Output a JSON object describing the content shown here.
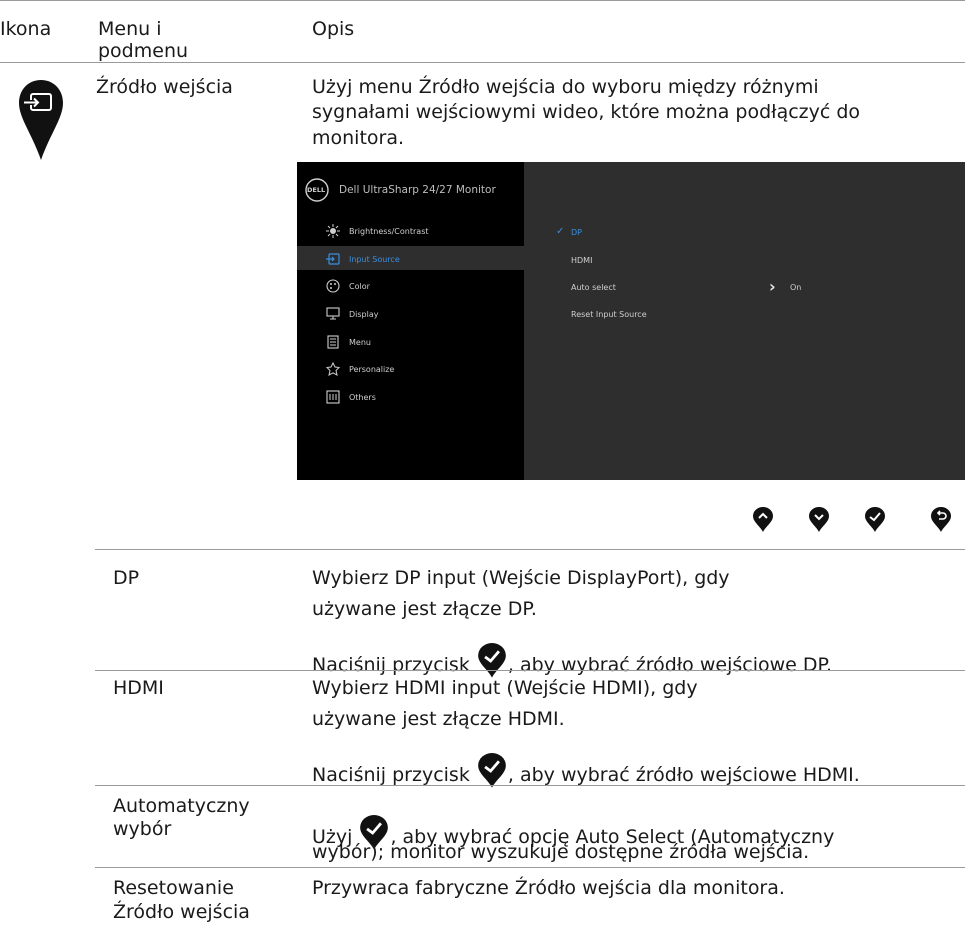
{
  "header": {
    "col_icon": "Ikona",
    "col_menu_l1": "Menu i",
    "col_menu_l2": "podmenu",
    "col_desc": "Opis"
  },
  "input_source": {
    "title": "Źródło wejścia",
    "desc_l1": "Użyj menu Źródło wejścia do wyboru między różnymi",
    "desc_l2": "sygnałami wejściowymi wideo, które można podłączyć do",
    "desc_l3": "monitora."
  },
  "osd": {
    "logo": "DELL",
    "title": "Dell UltraSharp 24/27 Monitor",
    "menu": [
      "Brightness/Contrast",
      "Input Source",
      "Color",
      "Display",
      "Menu",
      "Personalize",
      "Others"
    ],
    "options": [
      "DP",
      "HDMI",
      "Auto select",
      "Reset Input Source"
    ],
    "checkmark": "✓",
    "auto_value": "On",
    "arrow": "›"
  },
  "buttons": [
    "up-icon",
    "down-icon",
    "check-icon",
    "back-icon"
  ],
  "rows": {
    "dp": {
      "name": "DP",
      "l1": "Wybierz DP input (Wejście DisplayPort), gdy",
      "l2": "używane jest złącze DP.",
      "l3a": "Naciśnij przycisk ",
      "l3b": ", aby wybrać źródło wejściowe DP."
    },
    "hdmi": {
      "name": "HDMI",
      "l1": "Wybierz HDMI input (Wejście HDMI), gdy",
      "l2": "używane jest złącze HDMI.",
      "l3a": "Naciśnij przycisk ",
      "l3b": ", aby wybrać źródło wejściowe HDMI."
    },
    "auto": {
      "name_l1": "Automatyczny",
      "name_l2": "wybór",
      "l1a": "Użyj ",
      "l1b": ", aby wybrać opcję Auto Select (Automatyczny",
      "l2": "wybór); monitor wyszukuje dostępne źródła wejścia."
    },
    "reset": {
      "name_l1": "Resetowanie",
      "name_l2": "Źródło wejścia",
      "l1": "Przywraca fabryczne Źródło wejścia dla monitora."
    }
  },
  "colors": {
    "osd_bg": "#2e2e2e",
    "osd_left": "#000000",
    "accent": "#3a8fe0"
  }
}
